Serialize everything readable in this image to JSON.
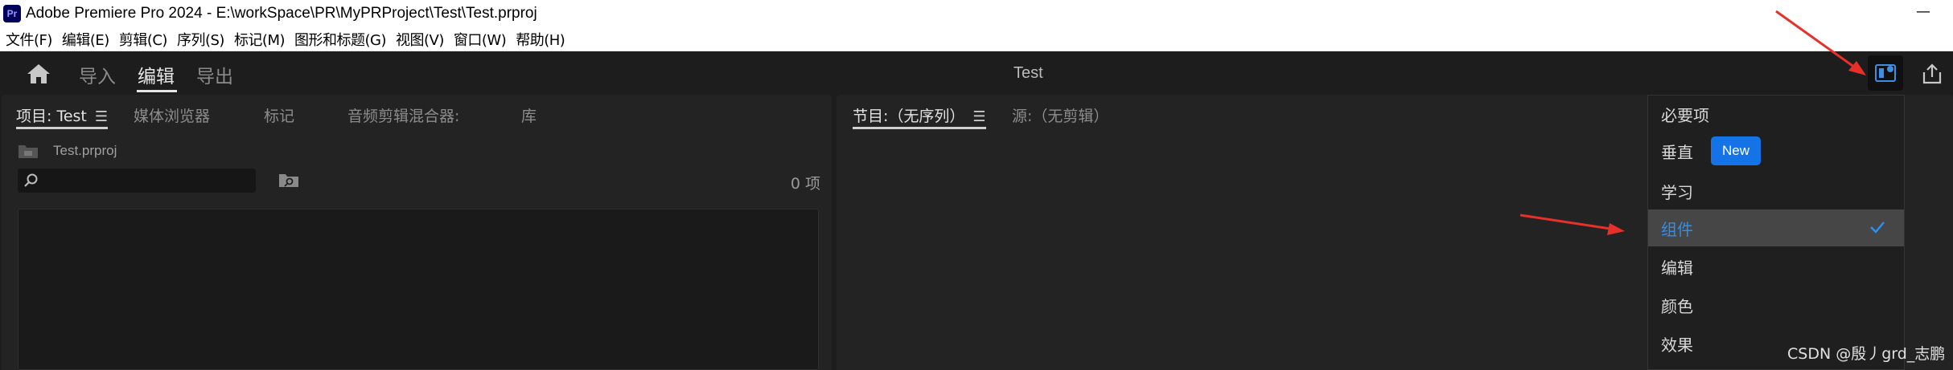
{
  "window": {
    "app_badge": "Pr",
    "title": "Adobe Premiere Pro 2024 - E:\\workSpace\\PR\\MyPRProject\\Test\\Test.prproj",
    "minimize": "—"
  },
  "menu": {
    "items": [
      "文件(F)",
      "编辑(E)",
      "剪辑(C)",
      "序列(S)",
      "标记(M)",
      "图形和标题(G)",
      "视图(V)",
      "窗口(W)",
      "帮助(H)"
    ]
  },
  "header": {
    "tabs": [
      "导入",
      "编辑",
      "导出"
    ],
    "active_tab": "编辑",
    "title": "Test"
  },
  "project_panel": {
    "tabs": [
      "项目: Test",
      "媒体浏览器",
      "标记",
      "音频剪辑混合器:",
      "库"
    ],
    "file": "Test.prproj",
    "item_count": "0 项",
    "search_placeholder": ""
  },
  "program_panel": {
    "tabs": [
      "节目:（无序列）",
      "源:（无剪辑）"
    ]
  },
  "workspace_menu": {
    "items": [
      "必要项",
      "垂直",
      "学习",
      "组件",
      "编辑",
      "颜色",
      "效果"
    ],
    "new_badge": "New",
    "selected": "组件"
  },
  "watermark": "CSDN @殷丿grd_志鹏",
  "colors": {
    "accent_blue": "#1473e6",
    "selected_text": "#2f8ff0",
    "annotation_arrow": "#e8302a"
  }
}
